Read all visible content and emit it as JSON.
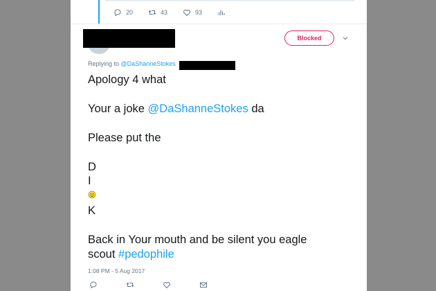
{
  "previous_tweet": {
    "reply_count": "20",
    "retweet_count": "43",
    "like_count": "93"
  },
  "tweet": {
    "blocked_label": "Blocked",
    "replying_prefix": "Replying to",
    "replying_mention": "@DaShanneStokes",
    "lines": {
      "l1": "Apology 4 what",
      "l2_a": "Your a joke ",
      "l2_mention": "@DaShanneStokes",
      "l2_b": " da",
      "l3": "Please put the",
      "l4": "D",
      "l5": "I",
      "l7": "K",
      "l8": "Back in Your mouth and be silent you eagle",
      "l9_a": "scout ",
      "l9_hashtag": "#pedophile"
    },
    "timestamp": "1:08 PM - 5 Aug 2017"
  },
  "colors": {
    "link": "#1da1f2",
    "blocked": "#e0245e",
    "meta": "#657786",
    "background": "#8a8a8a",
    "redaction": "#000000"
  },
  "icons": [
    "reply-icon",
    "retweet-icon",
    "like-icon",
    "analytics-icon",
    "chevron-down-icon",
    "smiley-emoji",
    "message-icon"
  ]
}
